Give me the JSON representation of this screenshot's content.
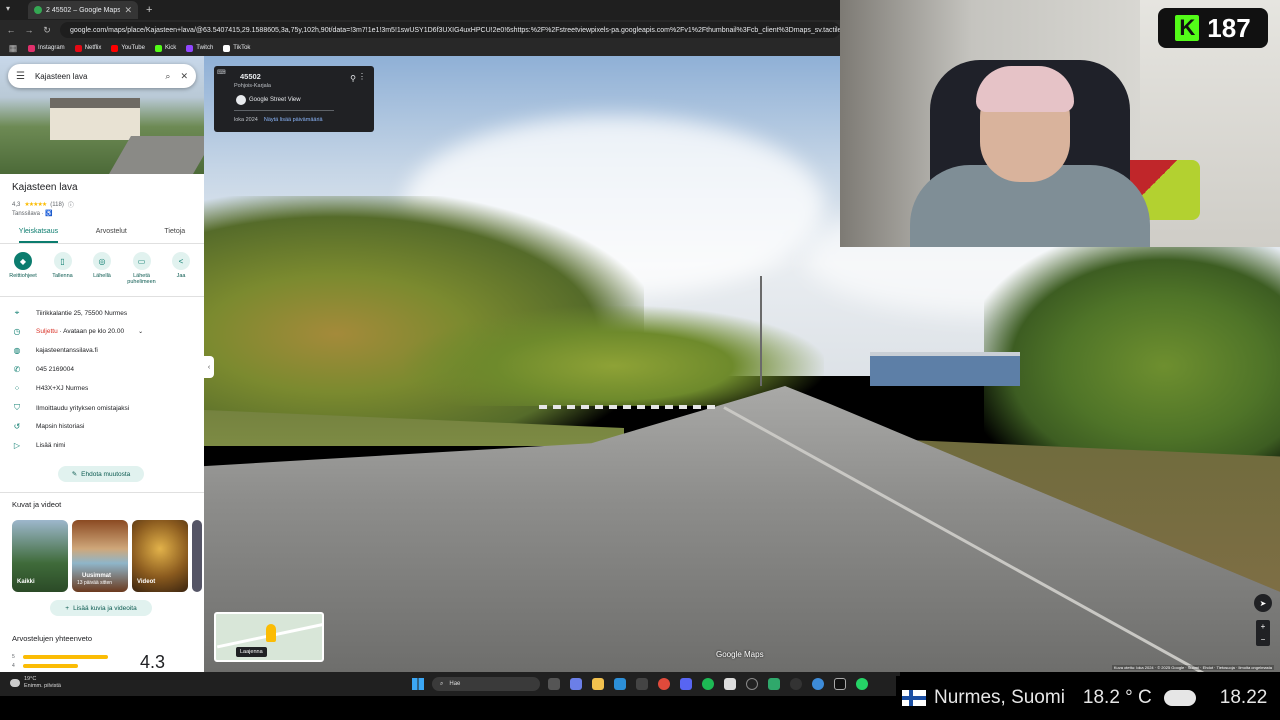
{
  "browser": {
    "tab_title": "2 45502 – Google Maps",
    "new_tab": "+",
    "url": "google.com/maps/place/Kajasteen+lava/@63.5407415,29.1588605,3a,75y,102h,90t/data=!3m7!1e1!3m5!1swUSY1D6f3UXIG4uxHPCU!2e0!6shttps:%2F%2Fstreetviewpixels-pa.googleapis.com%2Fv1%2Fthumbnail%3Fcb_client%3Dmaps_sv.tactile%",
    "bookmarks": [
      {
        "label": "Instagram",
        "color": "#e1306c"
      },
      {
        "label": "Netflix",
        "color": "#e50914"
      },
      {
        "label": "YouTube",
        "color": "#ff0000"
      },
      {
        "label": "Kick",
        "color": "#53fc18"
      },
      {
        "label": "Twitch",
        "color": "#9146ff"
      },
      {
        "label": "TikTok",
        "color": "#ffffff"
      }
    ]
  },
  "search": {
    "value": "Kajasteen lava"
  },
  "place": {
    "title": "Kajasteen lava",
    "rating": "4,3",
    "stars": "★★★★★",
    "review_count": "(118)",
    "category": "Tanssilava · ♿"
  },
  "tabs": [
    "Yleiskatsaus",
    "Arvostelut",
    "Tietoja"
  ],
  "actions": [
    {
      "label": "Reittiohjeet",
      "icon": "◆"
    },
    {
      "label": "Tallenna",
      "icon": "▯"
    },
    {
      "label": "Lähellä",
      "icon": "◎"
    },
    {
      "label": "Lähetä puhelimeen",
      "icon": "▭"
    },
    {
      "label": "Jaa",
      "icon": "<"
    }
  ],
  "info": {
    "address": "Tiirikkalantie 25, 75500 Nurmes",
    "status_closed": "Suljettu",
    "status_open": " · Avataan pe klo 20.00",
    "website": "kajasteentanssilava.fi",
    "phone": "045 2169004",
    "plus_code": "H43X+XJ Nurmes",
    "claim": "Ilmoittaudu yrityksen omistajaksi",
    "history": "Mapsin historiasi",
    "add_label": "Lisää nimi"
  },
  "edit_button": "Ehdota muutosta",
  "photos": {
    "title": "Kuvat ja videot",
    "items": [
      {
        "label": "Kaikki",
        "sub": ""
      },
      {
        "label": "Uusimmat",
        "sub": "13 päivää sitten"
      },
      {
        "label": "Videot",
        "sub": ""
      }
    ],
    "add": "Lisää kuvia ja videoita"
  },
  "reviews": {
    "title": "Arvostelujen yhteenveto",
    "bars": [
      {
        "star": "5",
        "fraction": 0.85
      },
      {
        "star": "4",
        "fraction": 0.55
      }
    ],
    "average": "4.3"
  },
  "streetview": {
    "card_title": "45502",
    "region": "Pohjois-Karjala",
    "service": "Google Street View",
    "date": "loka 2024",
    "more_dates": "Näytä lisää päivämääriä",
    "minimap_label": "Laajenna",
    "logo": "Google Maps",
    "attribution": "Kuva otettu: loka 2024 · © 2025 Google · Suomi · Ehdot · Tietosuoja · Ilmoita ongelmasta"
  },
  "stream": {
    "follower_count": "187",
    "location": "Nurmes, Suomi",
    "temperature": "18.2 ° C",
    "time": "18.22"
  },
  "taskbar": {
    "weather_temp": "19°C",
    "weather_desc": "Enimm. pilvistä",
    "search_placeholder": "Hae"
  }
}
